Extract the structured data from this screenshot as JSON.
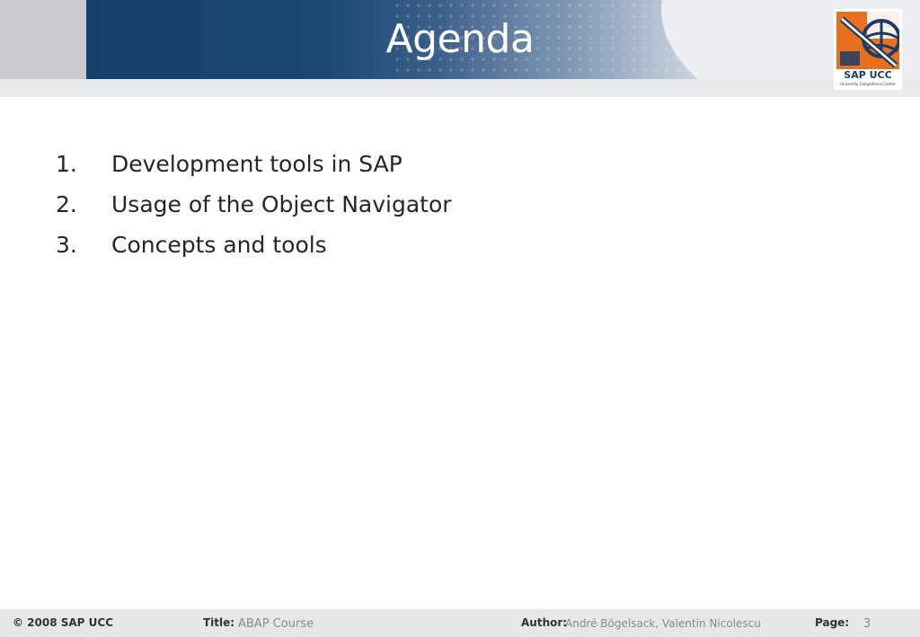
{
  "header": {
    "title": "Agenda"
  },
  "logo": {
    "name": "SAP UCC",
    "subtitle": "University Competence Center",
    "colors": {
      "orange": "#e8701f",
      "blue": "#1b3c69"
    }
  },
  "agenda": {
    "items": [
      {
        "number": "1.",
        "text": "Development tools in SAP"
      },
      {
        "number": "2.",
        "text": "Usage of the Object Navigator"
      },
      {
        "number": "3.",
        "text": "Concepts and tools"
      }
    ]
  },
  "footer": {
    "copyright": "© 2008 SAP UCC",
    "title_label": "Title:",
    "title_value": "ABAP Course",
    "author_label": "Author:",
    "author_value": "André Bögelsack, Valentin Nicolescu",
    "page_label": "Page:",
    "page_value": "3"
  },
  "colors": {
    "header_blue": "#173f6b",
    "header_gray": "#c9cbce",
    "text": "#262626",
    "footer_value": "#8a8a8a"
  }
}
